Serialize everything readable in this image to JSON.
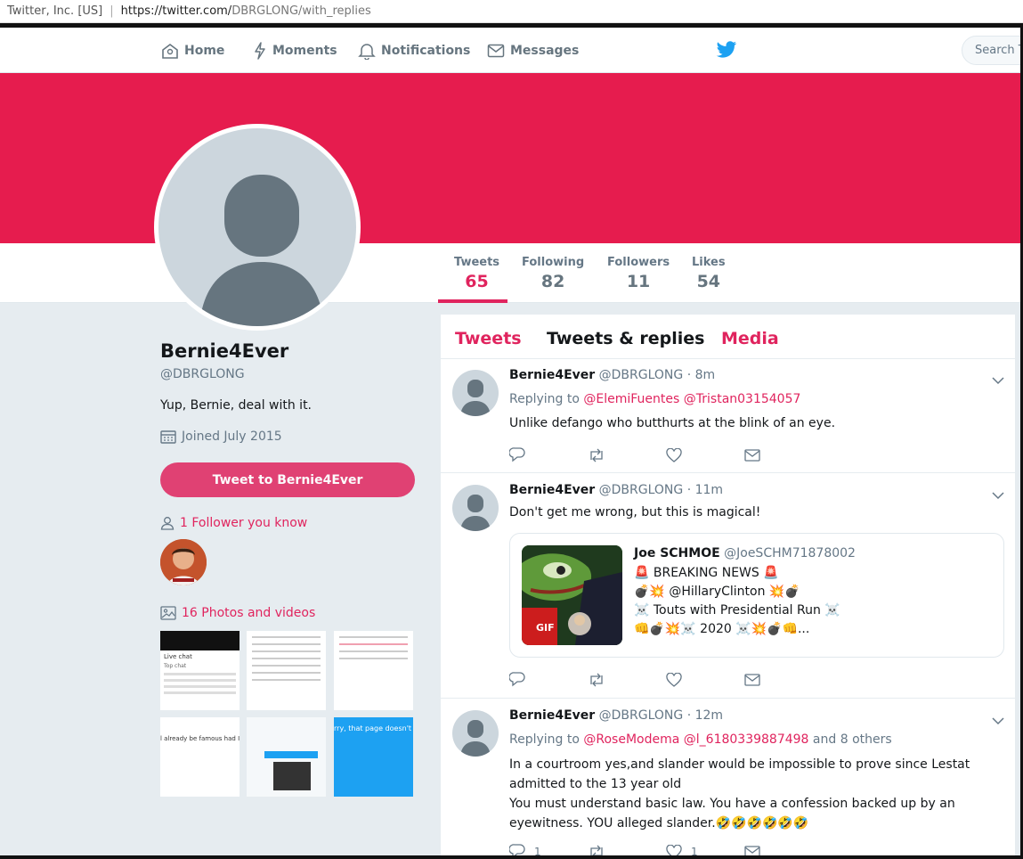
{
  "browser": {
    "site_identity": "Twitter, Inc. [US]",
    "url_prefix": "https://twitter.com/",
    "url_path": "DBRGLONG/with_replies"
  },
  "nav": {
    "home": "Home",
    "moments": "Moments",
    "notifications": "Notifications",
    "messages": "Messages",
    "search_placeholder": "Search Twitter"
  },
  "colors": {
    "banner": "#e61c4e",
    "accent": "#e0245e"
  },
  "stats": [
    {
      "label": "Tweets",
      "value": "65"
    },
    {
      "label": "Following",
      "value": "82"
    },
    {
      "label": "Followers",
      "value": "11"
    },
    {
      "label": "Likes",
      "value": "54"
    }
  ],
  "profile": {
    "name": "Bernie4Ever",
    "handle": "@DBRGLONG",
    "bio": "Yup, Bernie, deal with it.",
    "joined": "Joined July 2015",
    "tweet_to_button": "Tweet to Bernie4Ever",
    "followers_you_know": "1 Follower you know",
    "photos_videos": "16 Photos and videos"
  },
  "thumbnails": {
    "t1_title": "Live chat",
    "t1_sub": "Top chat",
    "t4_text": "l already be famous had I rocks",
    "t6_text": "rry, that page doesn't e"
  },
  "timeline_tabs": {
    "tweets": "Tweets",
    "tweets_replies": "Tweets & replies",
    "media": "Media"
  },
  "tweets": [
    {
      "name": "Bernie4Ever",
      "handle": "@DBRGLONG",
      "time": "· 8m",
      "replying_prefix": "Replying to",
      "mention1": "@ElemiFuentes",
      "mention2": "@Tristan03154057",
      "text": "Unlike defango who butthurts at the blink of an eye."
    },
    {
      "name": "Bernie4Ever",
      "handle": "@DBRGLONG",
      "time": "· 11m",
      "text": "Don't get me wrong, but this is magical!",
      "quote": {
        "name": "Joe SCHMOE",
        "handle": "@JoeSCHM71878002",
        "line1": "🚨 BREAKING NEWS 🚨",
        "line2": "💣💥 @HillaryClinton 💥💣",
        "line3": "☠️ Touts with Presidential Run ☠️",
        "line4": "👊💣💥☠️ 2020 ☠️💥💣👊...",
        "gif": "GIF"
      }
    },
    {
      "name": "Bernie4Ever",
      "handle": "@DBRGLONG",
      "time": "· 12m",
      "replying_prefix": "Replying to",
      "mention1": "@RoseModema",
      "mention2": "@l_6180339887498",
      "others": "and 8 others",
      "text1": "In a courtroom yes,and slander would be impossible to prove since Lestat admitted to the 13 year old",
      "text2": "You must understand basic law. You have a confession backed up by an eyewitness. YOU alleged slander.🤣🤣🤣🤣🤣🤣",
      "reply_count": "1",
      "like_count": "1"
    }
  ]
}
